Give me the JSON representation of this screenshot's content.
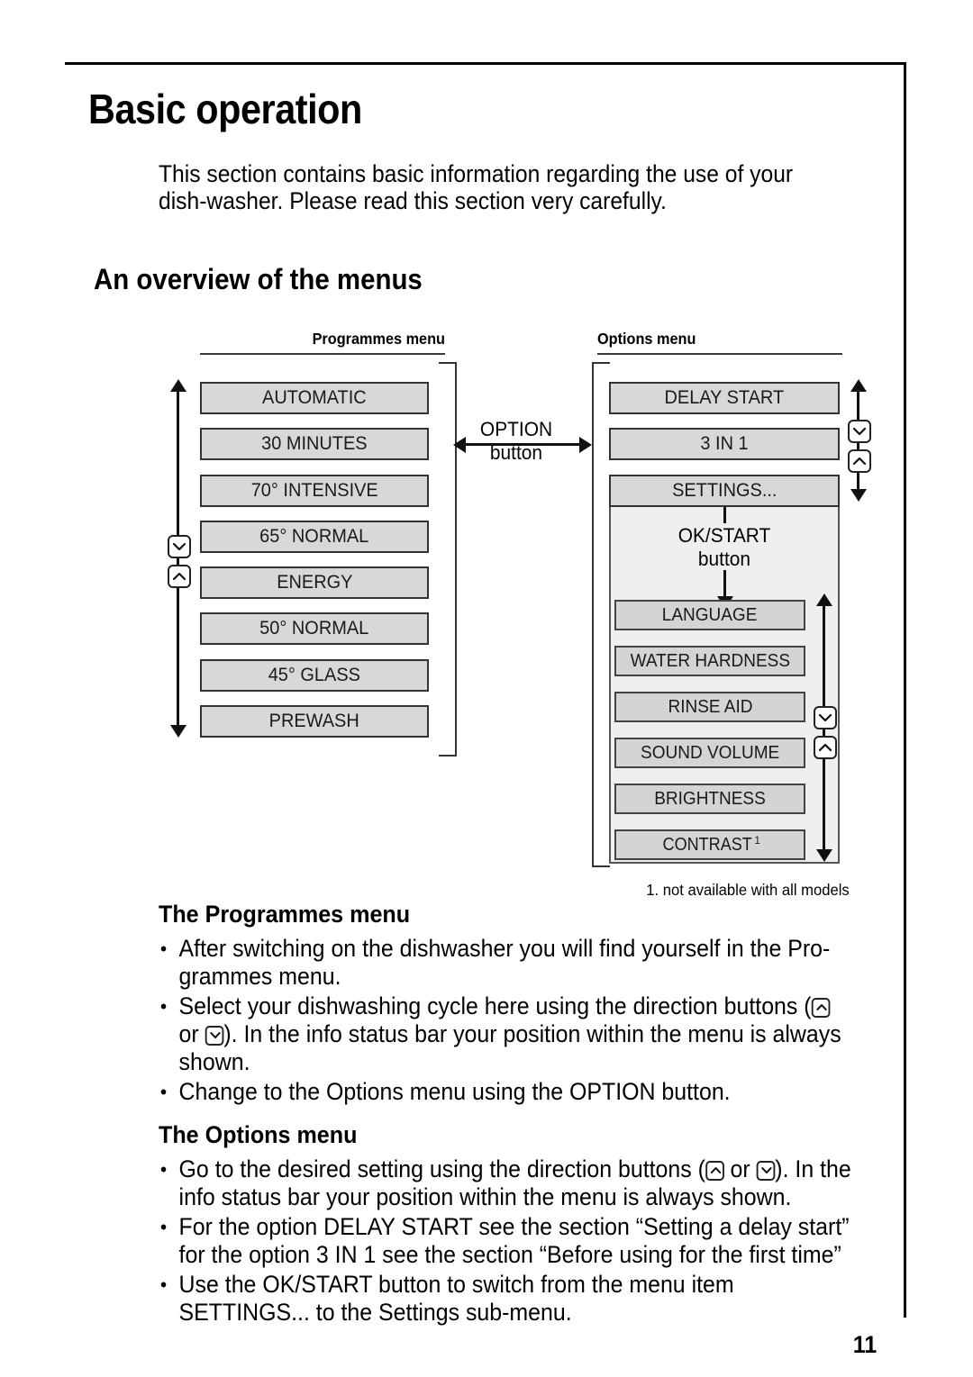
{
  "page": {
    "title": "Basic operation",
    "intro": "This section contains basic information regarding the use of your dish-washer. Please read this section very carefully.",
    "section_heading": "An overview of the menus",
    "page_number": "11"
  },
  "diagram": {
    "programmes": {
      "title": "Programmes menu",
      "items": [
        "AUTOMATIC",
        "30 MINUTES",
        "70° INTENSIVE",
        "65° NORMAL",
        "ENERGY",
        "50° NORMAL",
        "45° GLASS",
        "PREWASH"
      ]
    },
    "options": {
      "title": "Options menu",
      "items": [
        "DELAY START",
        "3 IN 1",
        "SETTINGS..."
      ],
      "settings_submenu": [
        "LANGUAGE",
        "WATER HARDNESS",
        "RINSE AID",
        "SOUND VOLUME",
        "BRIGHTNESS",
        "CONTRAST"
      ],
      "contrast_footnote_marker": "1"
    },
    "option_button_label_line1": "OPTION",
    "option_button_label_line2": "button",
    "ok_button_label_line1": "OK/START",
    "ok_button_label_line2": "button",
    "footnote": "1. not available with all models",
    "icons": {
      "down": "chevron-down-icon",
      "up": "chevron-up-icon"
    }
  },
  "programmes_section": {
    "heading": "The Programmes menu",
    "bullets": [
      "After switching on the dishwasher you will find yourself in the Pro-grammes menu.",
      "Select your dishwashing cycle here using the direction buttons (",
      "Change to the Options menu using the OPTION button."
    ],
    "bullet2_part_a": "Select your dishwashing cycle here using the direction buttons (",
    "bullet2_part_b": " or ",
    "bullet2_part_c": "). In the info status bar your position within the menu is always shown."
  },
  "options_section": {
    "heading": "The Options menu",
    "bullet1_part_a": "Go to the desired setting using the direction buttons (",
    "bullet1_part_b": " or ",
    "bullet1_part_c": "). In the info status bar your position within the menu is always shown.",
    "bullet2": "For the option DELAY START see the section “Setting a delay start” for the option 3 IN 1 see the section “Before using for the first time”",
    "bullet3": "Use the OK/START button to switch from the menu item SETTINGS... to the Settings sub-menu."
  }
}
